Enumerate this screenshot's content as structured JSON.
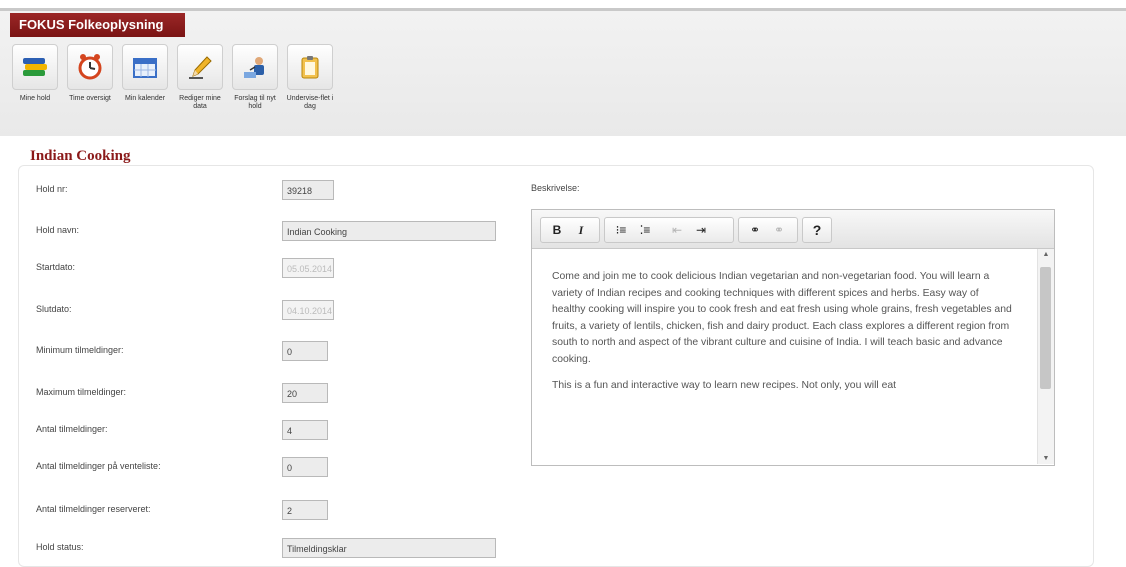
{
  "app": {
    "brand": "FOKUS Folkeoplysning"
  },
  "toolbar": {
    "items": [
      {
        "label": "Mine hold",
        "icon": "teams-icon"
      },
      {
        "label": "Time oversigt",
        "icon": "clock-icon"
      },
      {
        "label": "Min kalender",
        "icon": "calendar-icon"
      },
      {
        "label": "Rediger mine data",
        "icon": "pencil-icon"
      },
      {
        "label": "Forslag til nyt hold",
        "icon": "presenter-icon"
      },
      {
        "label": "Undervise-flet i dag",
        "icon": "clipboard-icon"
      }
    ]
  },
  "page": {
    "title": "Indian Cooking"
  },
  "form": {
    "fields": [
      {
        "label": "Hold nr:",
        "value": "39218"
      },
      {
        "label": "Hold navn:",
        "value": "Indian Cooking"
      },
      {
        "label": "Startdato:",
        "value": "05.05.2014"
      },
      {
        "label": "Slutdato:",
        "value": "04.10.2014"
      },
      {
        "label": "Minimum tilmeldinger:",
        "value": "0"
      },
      {
        "label": "Maximum tilmeldinger:",
        "value": "20"
      },
      {
        "label": "Antal tilmeldinger:",
        "value": "4"
      },
      {
        "label": "Antal tilmeldinger på venteliste:",
        "value": "0"
      },
      {
        "label": "Antal tilmeldinger reserveret:",
        "value": "2"
      },
      {
        "label": "Hold status:",
        "value": "Tilmeldingsklar"
      }
    ]
  },
  "description": {
    "label": "Beskrivelse:",
    "toolbar": {
      "bold": "B",
      "italic": "I",
      "help": "?"
    },
    "paragraphs": [
      "Come and join me to cook delicious Indian vegetarian and non-vegetarian food. You will learn a variety of Indian recipes and cooking techniques with different spices and herbs. Easy way of healthy cooking will inspire you to cook fresh and eat fresh using whole grains, fresh vegetables and fruits, a variety of lentils, chicken, fish and dairy product. Each class explores a different region from south to north and aspect of the vibrant culture and cuisine of India. I will teach basic and advance cooking.",
      "This is a fun and interactive way to learn new recipes. Not only, you will eat"
    ]
  },
  "colors": {
    "brand": "#8b1a1a",
    "accent_title": "#8b1a1a"
  }
}
